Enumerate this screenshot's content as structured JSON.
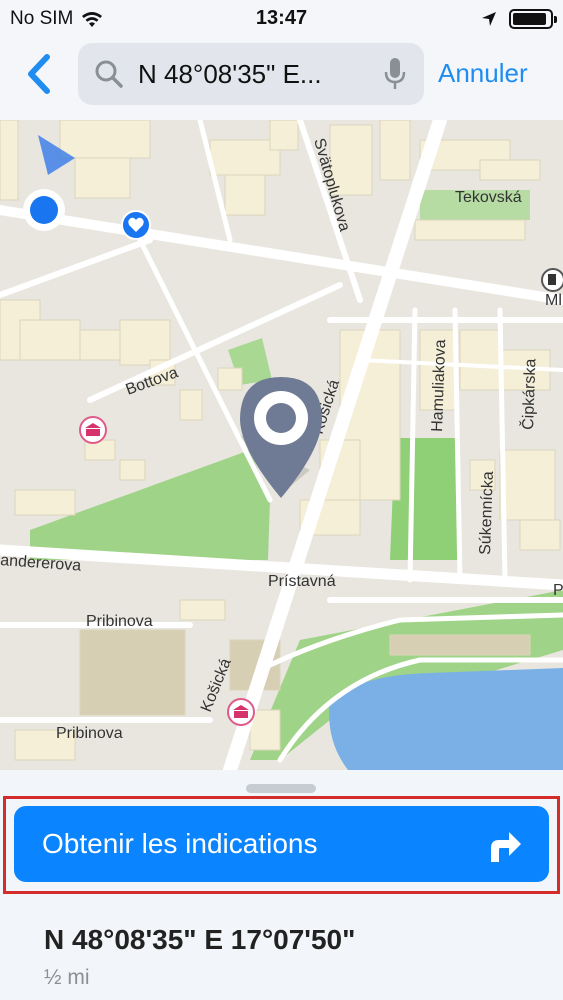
{
  "status_bar": {
    "carrier": "No SIM",
    "time": "13:47",
    "battery_level": 0.92,
    "icons": [
      "wifi-icon",
      "location-arrow-icon",
      "battery-icon"
    ]
  },
  "search": {
    "query": "N 48°08'35\" E...",
    "cancel_label": "Annuler",
    "icons": [
      "chevron-left-icon",
      "search-icon",
      "microphone-icon"
    ]
  },
  "map": {
    "street_labels": {
      "svatoplukova": "Svätoplukova",
      "tekovska": "Tekovská",
      "bottova": "Bottova",
      "kosicka_north": "Košická",
      "hamuliakova": "Hamuliakova",
      "cipkarska": "Čipkárska",
      "sukennicka": "Súkennícka",
      "landererova": "andererova",
      "pristavna": "Prístavná",
      "pribinova_1": "Pribinova",
      "pribinova_2": "Pribinova",
      "kosicka_south": "Košická",
      "edge_m": "Ml",
      "edge_p": "P"
    },
    "icons": [
      "user-location-icon",
      "favorite-heart-icon",
      "museum-icon",
      "gas-station-icon",
      "selected-pin-icon"
    ],
    "colors": {
      "water": "#7ab0e6",
      "park": "#8fcf76",
      "building": "#f5efd8",
      "road": "#ffffff"
    }
  },
  "panel": {
    "directions_label": "Obtenir les indications",
    "place_title": "N 48°08'35\" E 17°07'50\"",
    "distance": "½ mi",
    "accent_color": "#0a84ff"
  }
}
